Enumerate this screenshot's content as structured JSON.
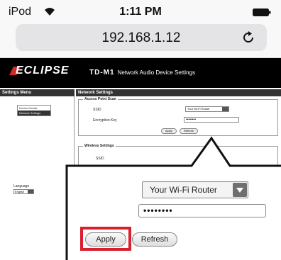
{
  "status_bar": {
    "carrier": "iPod",
    "time": "1:11 PM"
  },
  "browser": {
    "url": "192.168.1.12",
    "icons": [
      "wifi-icon",
      "battery-icon",
      "reload-icon"
    ]
  },
  "header": {
    "brand": "ECLIPSE",
    "model": "TD-M1",
    "title": "Network Audio Device Settings"
  },
  "sidebar": {
    "heading": "Settings Menu",
    "items": [
      {
        "label": "Device Details",
        "active": false
      },
      {
        "label": "Network Settings",
        "active": true
      }
    ],
    "language_label": "Language",
    "language_value": "English"
  },
  "main": {
    "heading": "Network Settings",
    "access_point_scan": {
      "legend": "Access Point Scan",
      "ssid_label": "SSID",
      "ssid_value": "Your Wi-Fi Router",
      "key_label": "Encryption Key",
      "key_value": "••••••••",
      "apply_label": "Apply",
      "refresh_label": "Refresh"
    },
    "wireless_settings": {
      "legend": "Wireless Settings",
      "ssid_label": "SSID"
    }
  },
  "callout": {
    "ssid_value": "Your Wi-Fi Router",
    "key_value": "••••••••",
    "apply_label": "Apply",
    "refresh_label": "Refresh",
    "highlight_color": "#d8202f"
  }
}
